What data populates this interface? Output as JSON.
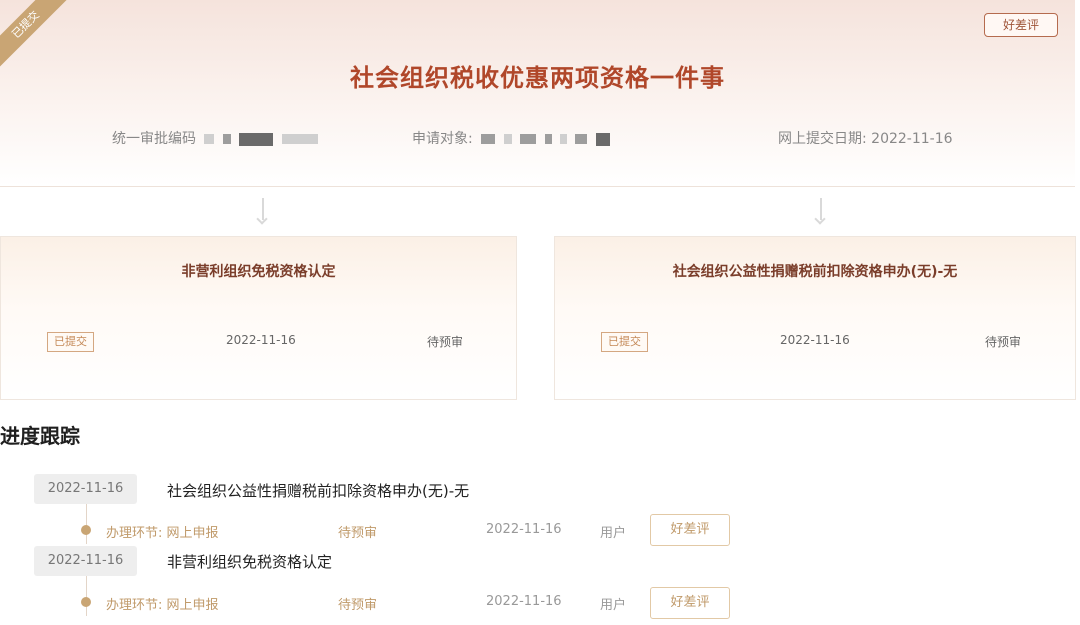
{
  "header": {
    "ribbon": "已提交",
    "rate_button": "好差评",
    "title": "社会组织税收优惠两项资格一件事",
    "code_label": "统一审批编码",
    "applicant_label": "申请对象:",
    "submit_date_label": "网上提交日期:",
    "submit_date": "2022-11-16"
  },
  "items": [
    {
      "title": "非营利组织免税资格认定",
      "status": "已提交",
      "date": "2022-11-16",
      "state": "待预审"
    },
    {
      "title": "社会组织公益性捐赠税前扣除资格申办(无)-无",
      "status": "已提交",
      "date": "2022-11-16",
      "state": "待预审"
    }
  ],
  "progress": {
    "title": "进度跟踪",
    "entries": [
      {
        "date": "2022-11-16",
        "title": "社会组织公益性捐赠税前扣除资格申办(无)-无",
        "step_label": "办理环节: 网上申报",
        "state": "待预审",
        "step_date": "2022-11-16",
        "actor": "用户",
        "rate": "好差评"
      },
      {
        "date": "2022-11-16",
        "title": "非营利组织免税资格认定",
        "step_label": "办理环节: 网上申报",
        "state": "待预审",
        "step_date": "2022-11-16",
        "actor": "用户",
        "rate": "好差评"
      }
    ]
  },
  "colors": {
    "accent": "#b0472a",
    "gold": "#c9a574",
    "header_bg": "#f5e3dc"
  }
}
